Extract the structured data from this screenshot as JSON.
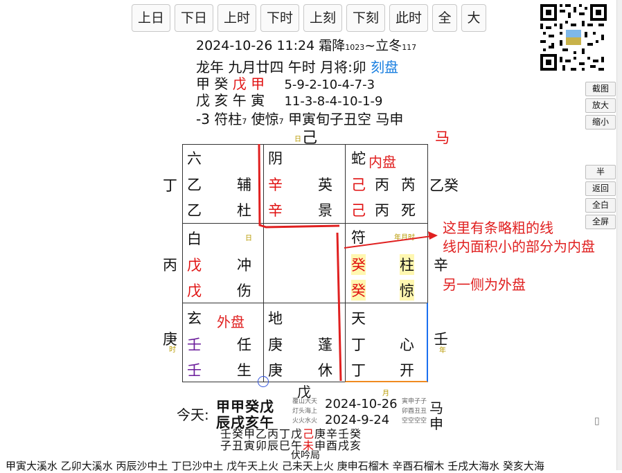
{
  "nav": {
    "buttons": [
      {
        "label": "上日"
      },
      {
        "label": "下日"
      },
      {
        "label": "上时"
      },
      {
        "label": "下时"
      },
      {
        "label": "上刻"
      },
      {
        "label": "下刻"
      },
      {
        "label": "此时"
      },
      {
        "label": "全"
      },
      {
        "label": "大"
      }
    ]
  },
  "side": {
    "group1": [
      "截图",
      "放大",
      "缩小"
    ],
    "group2": [
      "半",
      "返回",
      "全白",
      "全屏"
    ]
  },
  "header": {
    "datetime": "2024-10-26 11:24 霜降",
    "term_a_num": "1023",
    "term_sep": "~立冬",
    "term_b_num": "117",
    "lunar": "龙年 九月廿四 午时 月将:卯",
    "ke_pan": "刻盘",
    "stem_a": "甲 癸",
    "stem_b": "戊 甲",
    "numbers_a": "5-9-2-10-4-7-3",
    "branch_row": "戊 亥 午 寅",
    "numbers_b": "11-3-8-4-10-1-9",
    "line4_a": "-3 符柱",
    "line4_a_sub": "7",
    "line4_b": "使惊",
    "line4_b_sub": "7",
    "line4_c": "甲寅旬子丑空 马申"
  },
  "board": {
    "top_char": "己",
    "top_sub": "日",
    "horse": "马",
    "left": [
      "丁",
      "丙",
      "庚"
    ],
    "left_sub": "时",
    "right": [
      "乙癸",
      "辛",
      "壬"
    ],
    "right_sub": "年",
    "bottom_char": "戊",
    "bottom_sub": "月",
    "cells": {
      "nw": {
        "god": "六",
        "r1a": "乙",
        "r1b": "辅",
        "r2a": "乙",
        "r2b": "杜"
      },
      "n": {
        "god": "阴",
        "r1a": "辛",
        "r1b": "英",
        "r2a": "辛",
        "r2b": "景"
      },
      "ne": {
        "god": "蛇",
        "r1a": "己",
        "r1m": "丙",
        "r1b": "芮",
        "r2a": "己",
        "r2m": "丙",
        "r2b": "死"
      },
      "w": {
        "god": "白",
        "tag": "日",
        "r1a": "戊",
        "r1b": "冲",
        "r2a": "戊",
        "r2b": "伤"
      },
      "e": {
        "god": "符",
        "tag": "年月时",
        "r1a": "癸",
        "r1b": "柱",
        "r2a": "癸",
        "r2b": "惊"
      },
      "sw": {
        "god": "玄",
        "r1a": "壬",
        "r1b": "任",
        "r2a": "壬",
        "r2b": "生"
      },
      "s": {
        "god": "地",
        "r1a": "庚",
        "r1b": "蓬",
        "r2a": "庚",
        "r2b": "休"
      },
      "se": {
        "god": "天",
        "r1a": "丁",
        "r1b": "心",
        "r2a": "丁",
        "r2b": "开"
      }
    }
  },
  "annotations": {
    "inner_label": "内盘",
    "outer_label": "外盘",
    "note1": "这里有条略粗的线",
    "note2": "线内面积小的部分为内盘",
    "note3": "另一侧为外盘"
  },
  "bottom": {
    "today_label": "今天:",
    "gz1": "甲甲癸戊",
    "gz2": "辰戌亥午",
    "nayin_small": [
      "覆山大天",
      "灯头海上",
      "火火水火"
    ],
    "date1": "2024-10-26",
    "date2": "2024-9-24",
    "kong_small": [
      "寅申子子",
      "卯酉丑丑",
      "空空空空"
    ],
    "horse1": "马",
    "horse2": "申",
    "stems_row_a": "壬癸甲乙丙丁戊",
    "stems_row_red": "己",
    "stems_row_b": "庚辛壬癸",
    "branch_row_a": "子丑寅卯辰巳午",
    "branch_row_red": "未",
    "branch_row_b": "申酉戌亥",
    "fuyin": "伏吟局",
    "nayin_row": "甲寅大溪水 乙卯大溪水 丙辰沙中土 丁巳沙中土 戊午天上火 己未天上火 庚申石榴木 辛酉石榴木 壬戌大海水 癸亥大海"
  }
}
